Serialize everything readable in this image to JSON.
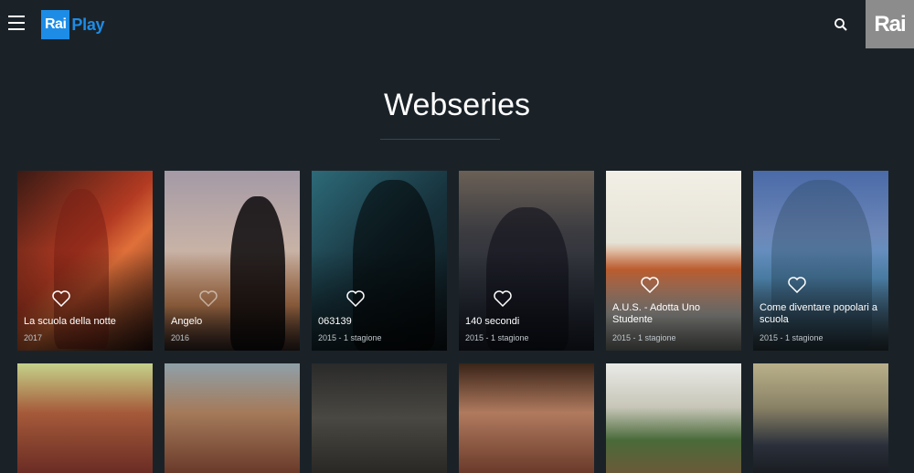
{
  "header": {
    "logo_rai": "Rai",
    "logo_play": "Play",
    "rai_badge": "Rai"
  },
  "page": {
    "title": "Webseries"
  },
  "cards_row1": [
    {
      "title": "La scuola della notte",
      "meta": "2017",
      "bg": "linear-gradient(135deg,#3a1a14 0%,#b23a22 45%,#e0703a 60%,#2a1410 100%)"
    },
    {
      "title": "Angelo",
      "meta": "2016",
      "bg": "linear-gradient(180deg,#a49aa6 0%,#c9b3a6 45%,#d88f5c 75%,#3a2a28 100%)"
    },
    {
      "title": "063139",
      "meta": "2015 - 1 stagione",
      "bg": "linear-gradient(135deg,#2d6a78 0%,#17323c 50%,#0c1418 100%)"
    },
    {
      "title": "140 secondi",
      "meta": "2015 - 1 stagione",
      "bg": "linear-gradient(180deg,#6a6056 0%,#3a3a40 35%,#2a2f3a 70%,#1d2230 100%)"
    },
    {
      "title": "A.U.S. - Adotta Uno Studente",
      "meta": "2015 - 1 stagione",
      "bg": "linear-gradient(180deg,#f2efe6 0%,#e5e2d6 40%,#d76a35 55%,#b7b7b2 80%,#8a8f88 100%)"
    },
    {
      "title": "Come diventare popolari a scuola",
      "meta": "2015 - 1 stagione",
      "bg": "linear-gradient(180deg,#4a6aa8 0%,#6d87b8 35%,#5a98c8 60%,#2f3c40 100%)"
    }
  ],
  "cards_row2": [
    {
      "bg": "linear-gradient(180deg,#c5d28a 0%,#a55a3a 45%,#6a2c24 100%)"
    },
    {
      "bg": "linear-gradient(180deg,#8fa0a8 0%,#a47a5a 45%,#6a3a2a 100%)"
    },
    {
      "bg": "linear-gradient(180deg,#2a2a2a 0%,#4a4842 50%,#2a2825 100%)"
    },
    {
      "bg": "linear-gradient(180deg,#3a2418 0%,#b07a5e 45%,#6a3a2a 100%)"
    },
    {
      "bg": "linear-gradient(180deg,#eaeae8 0%,#c7c6b8 40%,#4a6a3a 70%,#6a5a3a 100%)"
    },
    {
      "bg": "linear-gradient(180deg,#b9b08a 0%,#8a8266 40%,#2a2f3a 75%,#1a1d22 100%)"
    }
  ]
}
